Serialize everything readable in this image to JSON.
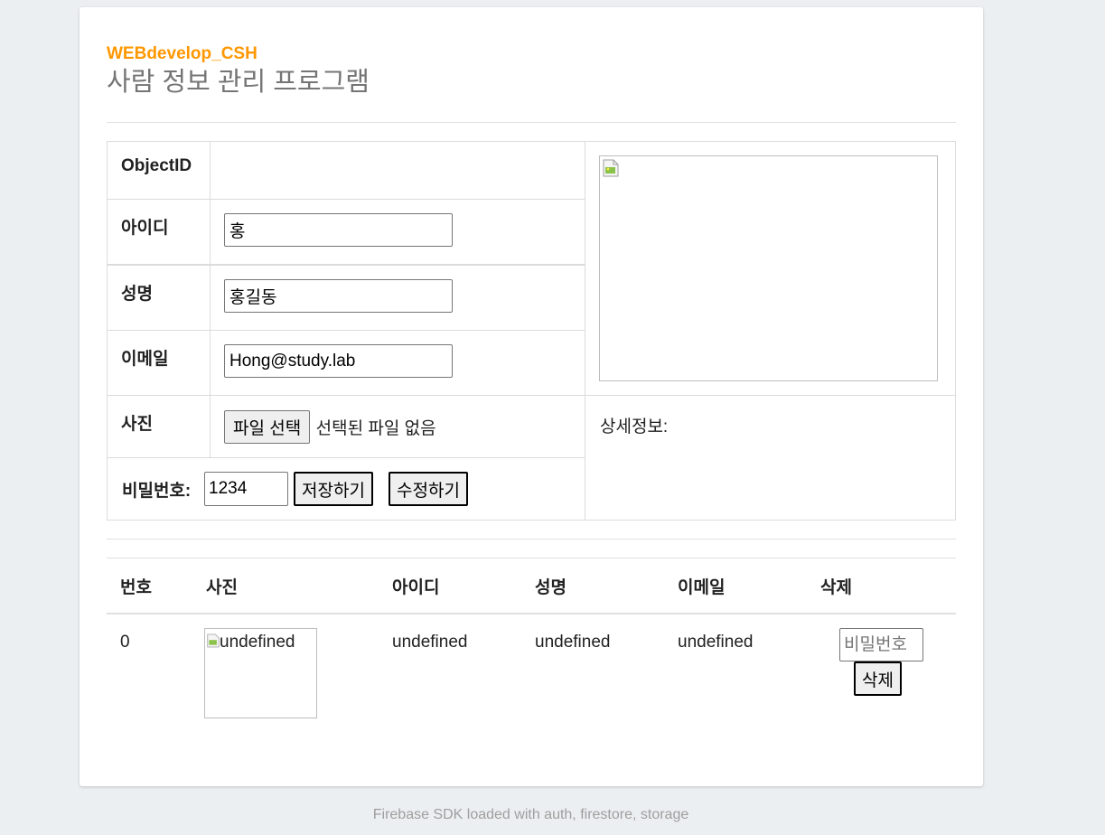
{
  "header": {
    "brand": "WEBdevelop_CSH",
    "title": "사람 정보 관리 프로그램"
  },
  "form": {
    "objectid_label": "ObjectID",
    "objectid_value": "",
    "id_label": "아이디",
    "id_value": "홍",
    "name_label": "성명",
    "name_value": "홍길동",
    "email_label": "이메일",
    "email_value": "Hong@study.lab",
    "photo_label": "사진",
    "file_button": "파일 선택",
    "file_status": "선택된 파일 없음",
    "password_label": "비밀번호:",
    "password_value": "1234",
    "save_button": "저장하기",
    "edit_button": "수정하기",
    "details_label": "상세정보:"
  },
  "table": {
    "headers": [
      "번호",
      "사진",
      "아이디",
      "성명",
      "이메일",
      "삭제"
    ],
    "rows": [
      {
        "number": "0",
        "photo_alt": "undefined",
        "id": "undefined",
        "name": "undefined",
        "email": "undefined",
        "delete_placeholder": "비밀번호",
        "delete_button": "삭제"
      }
    ]
  },
  "footer": {
    "text": "Firebase SDK loaded with auth, firestore, storage"
  }
}
